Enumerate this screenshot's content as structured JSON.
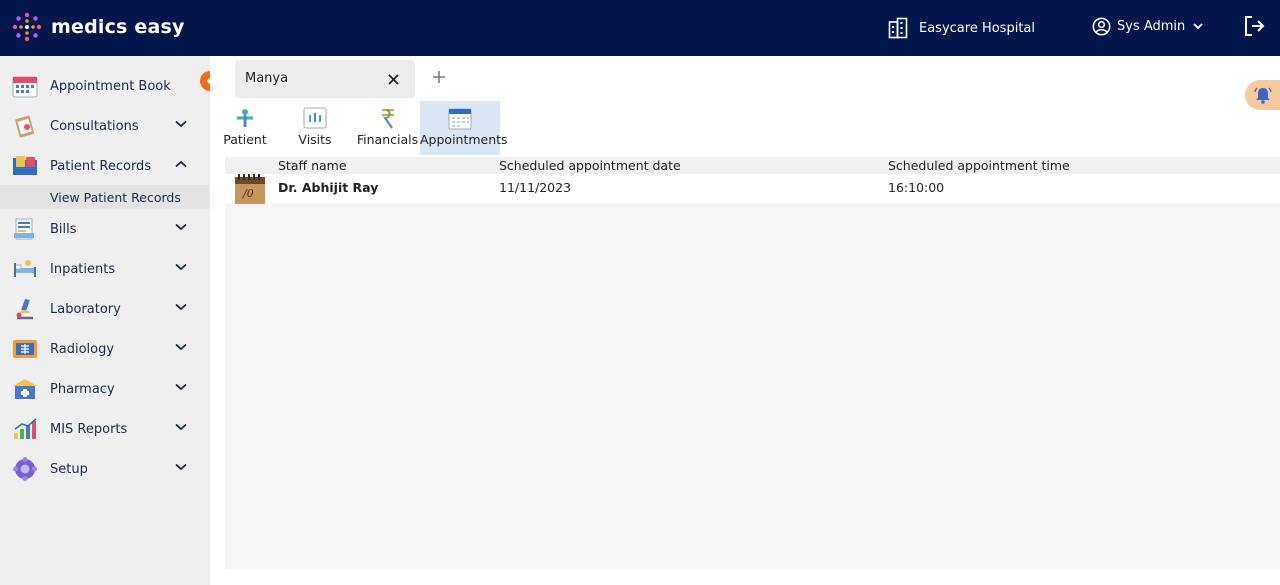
{
  "app": {
    "name": "medics easy"
  },
  "header": {
    "hospital": "Easycare Hospital",
    "user": "Sys Admin"
  },
  "sidebar": {
    "items": [
      {
        "label": "Appointment Book",
        "icon": "calendar-icon"
      },
      {
        "label": "Consultations",
        "icon": "clipboard-icon"
      },
      {
        "label": "Patient Records",
        "icon": "folder-icon",
        "expanded": true
      },
      {
        "label": "Bills",
        "icon": "bill-icon"
      },
      {
        "label": "Inpatients",
        "icon": "bed-icon"
      },
      {
        "label": "Laboratory",
        "icon": "microscope-icon"
      },
      {
        "label": "Radiology",
        "icon": "xray-icon"
      },
      {
        "label": "Pharmacy",
        "icon": "pharmacy-icon"
      },
      {
        "label": "MIS Reports",
        "icon": "chart-icon"
      },
      {
        "label": "Setup",
        "icon": "gear-icon"
      }
    ],
    "subitem": "View Patient Records"
  },
  "patient_tab": {
    "label": "Manya"
  },
  "toolbar": {
    "patient": "Patient",
    "visits": "Visits",
    "financials": "Financials",
    "appointments": "Appointments"
  },
  "grid": {
    "columns": [
      "Staff name",
      "Scheduled appointment date",
      "Scheduled appointment time"
    ],
    "rows": [
      {
        "staff": "Dr. Abhijit Ray",
        "date": "11/11/2023",
        "time": "16:10:00"
      }
    ]
  },
  "colors": {
    "header_bg": "#04174c",
    "accent": "#f26a1b",
    "active_tool": "#d9e6f5"
  }
}
